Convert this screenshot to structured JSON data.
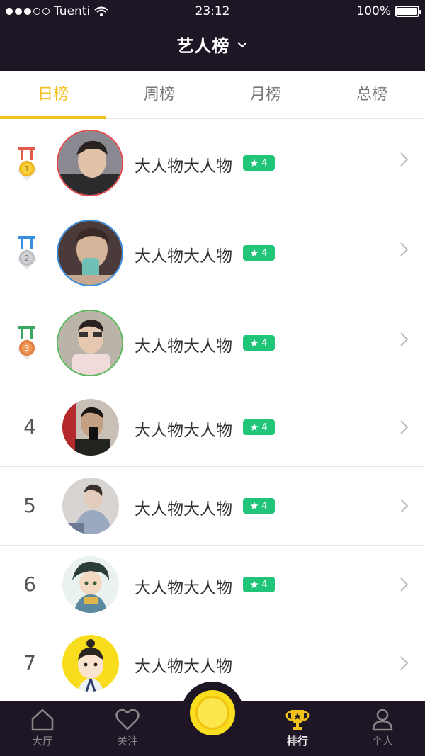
{
  "status_bar": {
    "carrier": "Tuenti",
    "time": "23:12",
    "battery": "100%"
  },
  "header": {
    "title": "艺人榜"
  },
  "tabs": [
    {
      "label": "日榜",
      "active": true
    },
    {
      "label": "周榜",
      "active": false
    },
    {
      "label": "月榜",
      "active": false
    },
    {
      "label": "总榜",
      "active": false
    }
  ],
  "list": [
    {
      "rank": "1",
      "medal": "gold",
      "name": "大人物大人物",
      "level": "4",
      "has_badge": true
    },
    {
      "rank": "2",
      "medal": "silver",
      "name": "大人物大人物",
      "level": "4",
      "has_badge": true
    },
    {
      "rank": "3",
      "medal": "bronze",
      "name": "大人物大人物",
      "level": "4",
      "has_badge": true
    },
    {
      "rank": "4",
      "medal": "",
      "name": "大人物大人物",
      "level": "4",
      "has_badge": true
    },
    {
      "rank": "5",
      "medal": "",
      "name": "大人物大人物",
      "level": "4",
      "has_badge": true
    },
    {
      "rank": "6",
      "medal": "",
      "name": "大人物大人物",
      "level": "4",
      "has_badge": true
    },
    {
      "rank": "7",
      "medal": "",
      "name": "大人物大人物",
      "level": "",
      "has_badge": false
    }
  ],
  "bottom_nav": [
    {
      "label": "大厅",
      "icon": "home-icon",
      "active": false
    },
    {
      "label": "关注",
      "icon": "heart-icon",
      "active": false
    },
    {
      "label": "排行",
      "icon": "trophy-icon",
      "active": true
    },
    {
      "label": "个人",
      "icon": "person-icon",
      "active": false
    }
  ],
  "colors": {
    "accent": "#f2c21c",
    "header_bg": "#1e1624",
    "badge": "#21c57a"
  }
}
